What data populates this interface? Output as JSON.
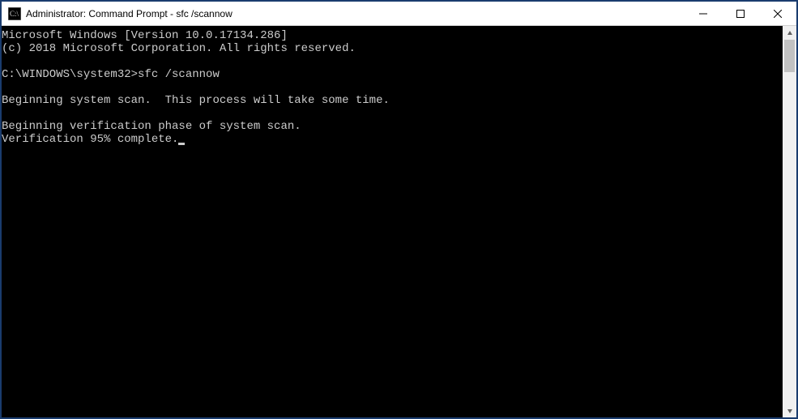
{
  "window": {
    "title": "Administrator: Command Prompt - sfc  /scannow"
  },
  "terminal": {
    "lines": [
      "Microsoft Windows [Version 10.0.17134.286]",
      "(c) 2018 Microsoft Corporation. All rights reserved.",
      "",
      "C:\\WINDOWS\\system32>sfc /scannow",
      "",
      "Beginning system scan.  This process will take some time.",
      "",
      "Beginning verification phase of system scan.",
      "Verification 95% complete."
    ],
    "prompt": "C:\\WINDOWS\\system32>",
    "command": "sfc /scannow",
    "progress_percent": 95
  }
}
